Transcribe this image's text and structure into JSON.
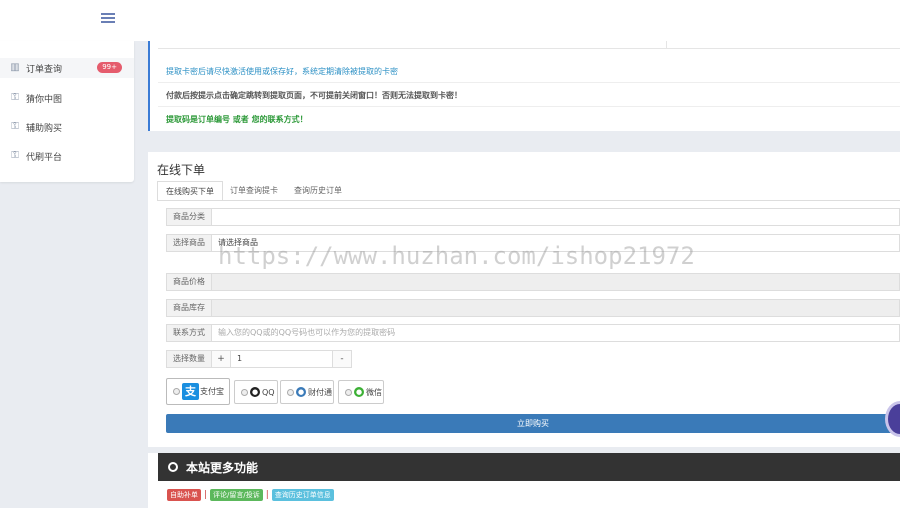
{
  "sidebar": {
    "items": [
      {
        "label": "订单查询",
        "badge": "99+",
        "icon": "bar-chart-icon"
      },
      {
        "label": "猜你中图",
        "icon": "key-icon"
      },
      {
        "label": "辅助购买",
        "icon": "key-icon"
      },
      {
        "label": "代刷平台",
        "icon": "key-icon"
      }
    ]
  },
  "notices": [
    "提取卡密后请尽快激活使用或保存好，系统定期清除被提取的卡密",
    "付款后按提示点击确定跳转到提取页面，不可提前关闭窗口！否则无法提取到卡密！",
    "提取码是订单编号 或者 您的联系方式！"
  ],
  "order": {
    "title": "在线下单",
    "tabs": [
      "在线购买下单",
      "订单查询提卡",
      "查询历史订单"
    ],
    "fields": {
      "category_label": "商品分类",
      "category_value": "",
      "product_label": "选择商品",
      "product_value": "请选择商品",
      "price_label": "商品价格",
      "stock_label": "商品库存",
      "contact_label": "联系方式",
      "contact_placeholder": "输入您的QQ或的QQ号码也可以作为您的提取密码",
      "qty_label": "选择数量",
      "qty_plus": "+",
      "qty_value": "1",
      "qty_minus": "-"
    },
    "payments": [
      "支付宝",
      "QQ",
      "财付通",
      "微信"
    ],
    "buy_label": "立即购买"
  },
  "more": {
    "title": "本站更多功能",
    "links": [
      {
        "label": "自助补单",
        "color": "#d9534f"
      },
      {
        "label": "评论/留言/投诉",
        "color": "#5cb85c"
      },
      {
        "label": "查询历史订单信息",
        "color": "#5bc0de"
      }
    ]
  },
  "watermark": "https://www.huzhan.com/ishop21972"
}
